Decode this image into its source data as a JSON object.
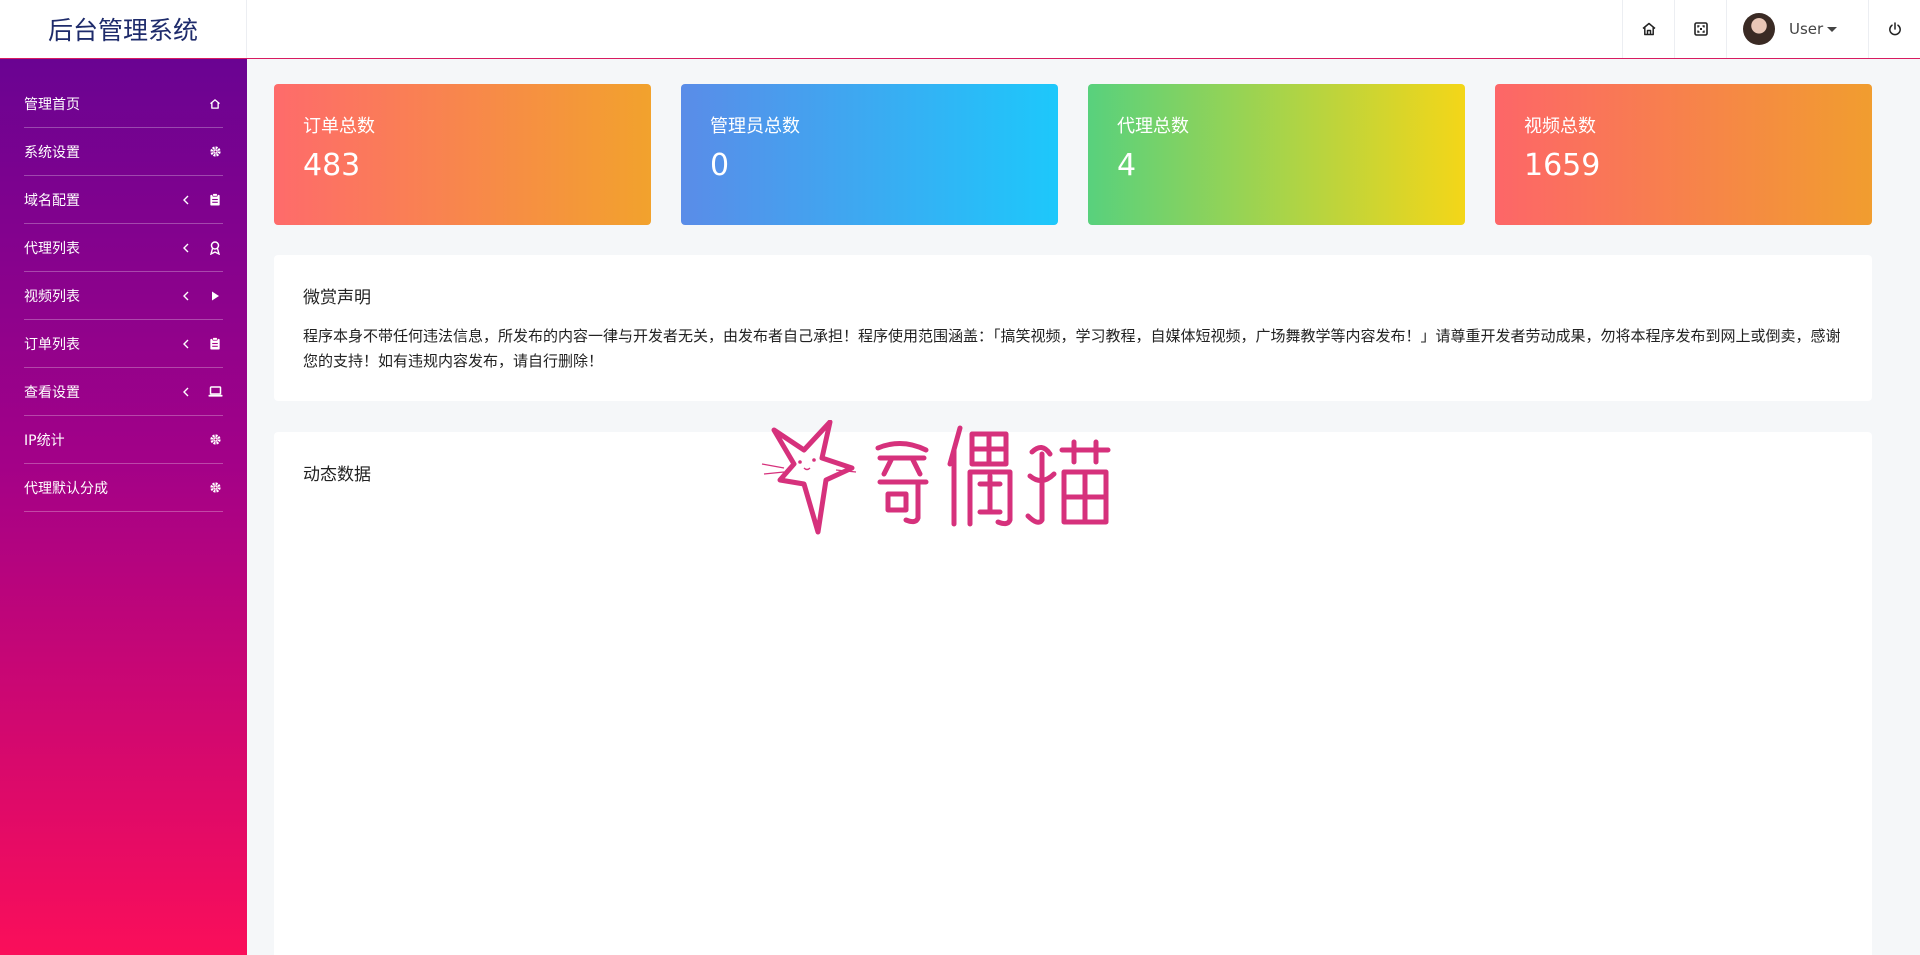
{
  "brand": {
    "title": "后台管理系统"
  },
  "header": {
    "home_icon": "home-icon",
    "fullscreen_icon": "fullscreen-icon",
    "user_name": "User",
    "power_icon": "power-icon"
  },
  "sidebar": {
    "items": [
      {
        "label": "管理首页",
        "icon": "home-icon",
        "expandable": false
      },
      {
        "label": "系统设置",
        "icon": "gear-icon",
        "expandable": false
      },
      {
        "label": "域名配置",
        "icon": "clipboard-icon",
        "expandable": true
      },
      {
        "label": "代理列表",
        "icon": "award-icon",
        "expandable": true
      },
      {
        "label": "视频列表",
        "icon": "play-icon",
        "expandable": true
      },
      {
        "label": "订单列表",
        "icon": "clipboard-icon",
        "expandable": true
      },
      {
        "label": "查看设置",
        "icon": "laptop-icon",
        "expandable": true
      },
      {
        "label": "IP统计",
        "icon": "gear-icon",
        "expandable": false
      },
      {
        "label": "代理默认分成",
        "icon": "gear-icon",
        "expandable": false
      }
    ]
  },
  "stats": [
    {
      "title": "订单总数",
      "value": "483"
    },
    {
      "title": "管理员总数",
      "value": "0"
    },
    {
      "title": "代理总数",
      "value": "4"
    },
    {
      "title": "视频总数",
      "value": "1659"
    }
  ],
  "notice": {
    "title": "微赏声明",
    "text": "程序本身不带任何违法信息，所发布的内容一律与开发者无关，由发布者自己承担！程序使用范围涵盖：「搞笑视频，学习教程，自媒体短视频，广场舞教学等内容发布！」请尊重开发者劳动成果，勿将本程序发布到网上或倒卖，感谢您的支持！如有违规内容发布，请自行删除！"
  },
  "dynamic": {
    "title": "动态数据"
  },
  "watermark": {
    "icon": "cat-logo-icon",
    "text": "奇偶猫",
    "color": "#d6317c"
  }
}
